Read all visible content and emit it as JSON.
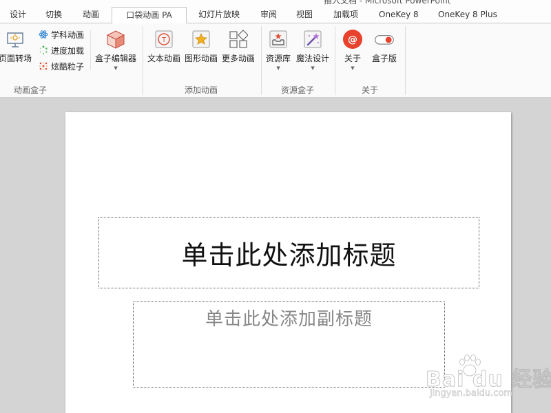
{
  "window": {
    "title_fragment": "插入文档 - Microsoft PowerPoint"
  },
  "tabs": [
    {
      "label": "设计"
    },
    {
      "label": "切换"
    },
    {
      "label": "动画"
    },
    {
      "label": "口袋动画 PA",
      "active": true
    },
    {
      "label": "幻灯片放映"
    },
    {
      "label": "审阅"
    },
    {
      "label": "视图"
    },
    {
      "label": "加载项"
    },
    {
      "label": "OneKey 8"
    },
    {
      "label": "OneKey 8 Plus"
    }
  ],
  "ribbon": {
    "groups": [
      {
        "label": "动画盒子",
        "buttons": [
          {
            "label": "页面转场",
            "icon": "page-transition-icon"
          },
          {
            "label": "学科动画",
            "icon": "subject-animation-icon"
          },
          {
            "label": "进度加载",
            "icon": "progress-loading-icon"
          },
          {
            "label": "炫酷粒子",
            "icon": "particle-icon"
          },
          {
            "label": "盒子编辑器",
            "icon": "box-editor-icon"
          }
        ]
      },
      {
        "label": "添加动画",
        "buttons": [
          {
            "label": "文本动画",
            "icon": "text-animation-icon"
          },
          {
            "label": "图形动画",
            "icon": "shape-animation-icon"
          },
          {
            "label": "更多动画",
            "icon": "more-animation-icon"
          }
        ]
      },
      {
        "label": "资源盒子",
        "buttons": [
          {
            "label": "资源库",
            "icon": "resource-library-icon"
          },
          {
            "label": "魔法设计",
            "icon": "magic-design-icon"
          }
        ]
      },
      {
        "label": "关于",
        "buttons": [
          {
            "label": "关于",
            "icon": "about-icon"
          },
          {
            "label": "盒子版",
            "icon": "toggle-icon"
          }
        ]
      }
    ]
  },
  "slide": {
    "title_placeholder": "单击此处添加标题",
    "subtitle_placeholder": "单击此处添加副标题"
  },
  "watermark": {
    "brand": "Bai du 经验",
    "url": "jingyan.baidu.com"
  },
  "colors": {
    "about_red": "#e8412c",
    "toggle_red": "#e8412c",
    "accent_pink": "#d9487a"
  }
}
